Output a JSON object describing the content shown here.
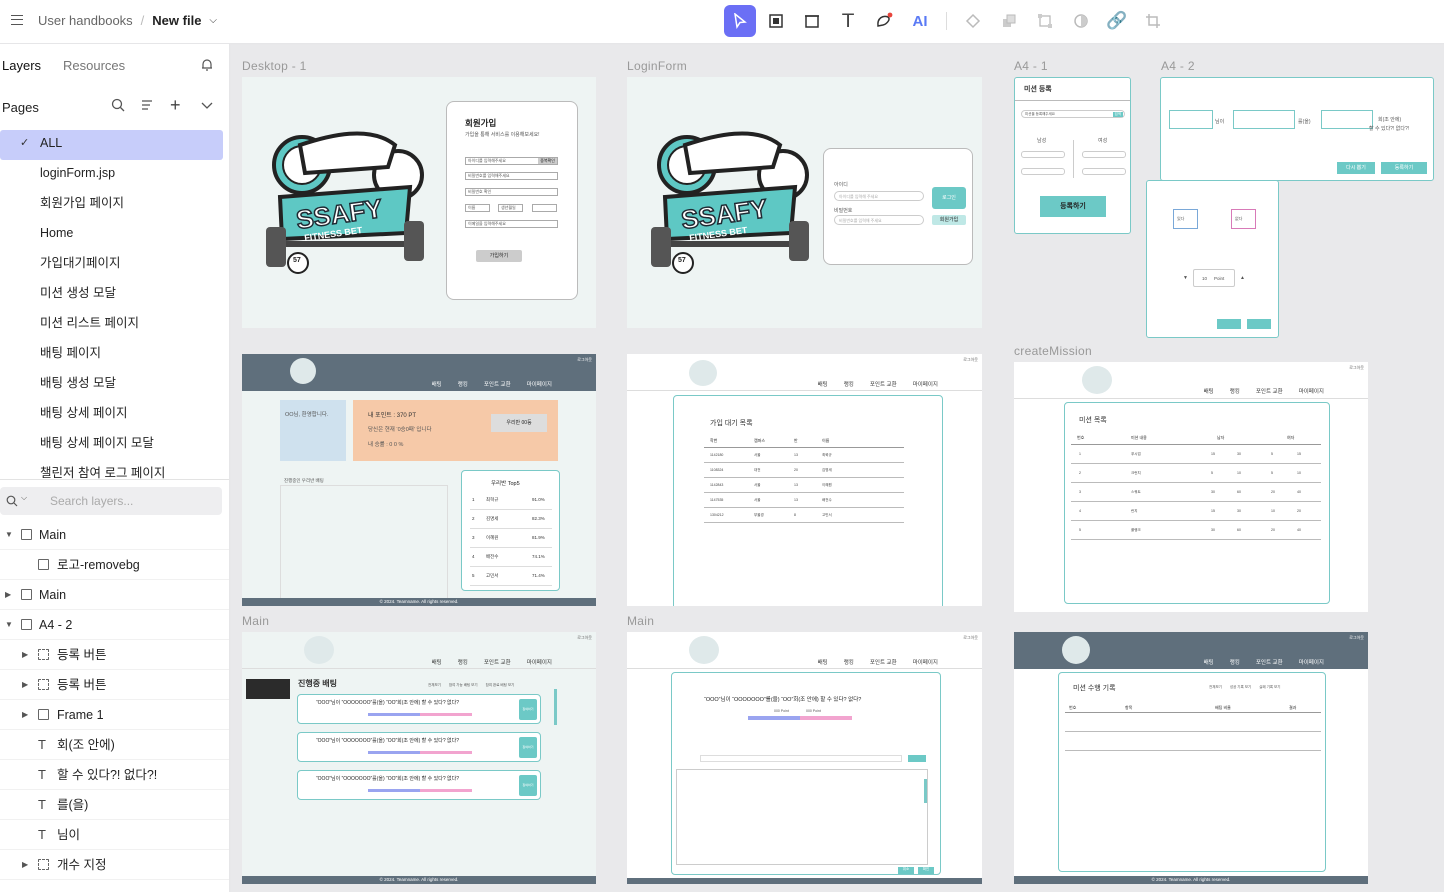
{
  "breadcrumb": {
    "project": "User handbooks",
    "separator": "/",
    "file": "New file"
  },
  "toolbar": {
    "tools": [
      "pointer-tool",
      "rectangle-tool",
      "frame-tool",
      "text-tool",
      "path-tool",
      "ai-tool",
      "component-tool",
      "group-tool",
      "transform-tool",
      "mask-tool",
      "link-tool",
      "crop-tool"
    ],
    "ai_label": "AI",
    "text_glyph": "T"
  },
  "sidebar": {
    "tab_layers": "Layers",
    "tab_resources": "Resources",
    "pages_label": "Pages",
    "pages": [
      "ALL",
      "loginForm.jsp",
      "회원가입 페이지",
      "Home",
      "가입대기페이지",
      "미션 생성 모달",
      "미션 리스트 페이지",
      "배팅 페이지",
      "배팅 생성 모달",
      "배팅 상세 페이지",
      "배팅 상세 페이지 모달",
      "챌린저 참여 로그 페이지"
    ],
    "search_placeholder": "Search layers...",
    "layers": [
      {
        "name": "Main",
        "type": "board",
        "expanded": true,
        "depth": 0
      },
      {
        "name": "로고-removebg",
        "type": "image",
        "depth": 1
      },
      {
        "name": "Main",
        "type": "board",
        "expanded": false,
        "depth": 0
      },
      {
        "name": "A4 - 2",
        "type": "board",
        "expanded": true,
        "depth": 0
      },
      {
        "name": "등록 버튼",
        "type": "group",
        "depth": 1
      },
      {
        "name": "등록 버튼",
        "type": "group",
        "depth": 1
      },
      {
        "name": "Frame 1",
        "type": "board",
        "depth": 1
      },
      {
        "name": "회(조 안에)",
        "type": "text",
        "depth": 1
      },
      {
        "name": "할 수 있다?! 없다?!",
        "type": "text",
        "depth": 1
      },
      {
        "name": "를(을)",
        "type": "text",
        "depth": 1
      },
      {
        "name": "님이",
        "type": "text",
        "depth": 1
      },
      {
        "name": "개수 지정",
        "type": "group",
        "depth": 1
      }
    ]
  },
  "canvas": {
    "frame_labels": {
      "desktop1": "Desktop - 1",
      "loginform": "LoginForm",
      "a4_1": "A4 - 1",
      "a4_2": "A4 - 2",
      "createmission": "createMission",
      "main1": "Main",
      "main2": "Main"
    },
    "brand": {
      "logo_line1": "SSAFY",
      "logo_line2": "FITNESS BET",
      "logo_number": "57"
    },
    "signup": {
      "title": "회원가입",
      "subtitle": "가입을 통해 서비스를 이용해보세요!",
      "button": "가입하기",
      "dup_check": "중복확인",
      "fields": [
        "아이디를 입력해주세요",
        "비밀번호를 입력해주세요",
        "비밀번호 확인",
        "이름",
        "생년월일",
        "이메일을 입력해주세요"
      ]
    },
    "login": {
      "id_label": "아이디",
      "pw_label": "비밀번호",
      "id_placeholder": "아이디를 입력해 주세요",
      "pw_placeholder": "비밀번호를 입력해 주세요",
      "login_button": "로그인",
      "signup_button": "회원가입"
    },
    "a4_1": {
      "title": "미션 등록",
      "input_placeholder": "미션을 등록해주세요",
      "search": "검색",
      "male": "남성",
      "female": "여성",
      "submit": "등록하기"
    },
    "a4_2": {
      "nim": "님이",
      "reul": "를(을)",
      "hoe": "회(조 안에)",
      "question": "할 수 있다?! 없다?!",
      "retry": "다시 뽑기",
      "register": "등록하기",
      "yes": "있다",
      "no": "없다",
      "point_value": "10",
      "point_unit": "Point"
    },
    "nav": {
      "logout": "로그아웃",
      "items": [
        "배팅",
        "랭킹",
        "포인트 교환",
        "마이페이지"
      ],
      "footer": "© 2024. Teamname. All rights reserved."
    },
    "home": {
      "welcome": "OO님, 환영합니다.",
      "mypoint": "내 포인트 : 370 PT",
      "status": "당신은 현재 ‘0승0패’ 입니다",
      "winrate": "내 승률 : 0 0 %",
      "team_btn": "우리반 00등",
      "ongoing": "진행중인 우리반 배팅",
      "top5_title": "우리반 Top5",
      "top5": [
        [
          "1",
          "최혁규",
          "91.0%"
        ],
        [
          "2",
          "김명세",
          "82.3%"
        ],
        [
          "3",
          "이혜원",
          "81.9%"
        ],
        [
          "4",
          "배전수",
          "74.1%"
        ],
        [
          "5",
          "고민서",
          "71.4%"
        ]
      ]
    },
    "waiting": {
      "title": "가입 대기 목록",
      "headers": [
        "학번",
        "캠퍼스",
        "반",
        "이름"
      ],
      "rows": [
        [
          "1142180",
          "서울",
          "13",
          "최혁규"
        ],
        [
          "1108324",
          "대전",
          "20",
          "김명세"
        ],
        [
          "1142843",
          "서울",
          "13",
          "이혜원"
        ],
        [
          "1147535",
          "서울",
          "13",
          "배전수"
        ],
        [
          "1304212",
          "부울경",
          "8",
          "고민서"
        ]
      ]
    },
    "mission_list": {
      "title": "미션 목록",
      "headers": [
        "번호",
        "미션 내용",
        "남자",
        "여자"
      ],
      "rows": [
        [
          "1",
          "푸시업",
          "15",
          "30",
          "5",
          "15"
        ],
        [
          "2",
          "크런치",
          "5",
          "10",
          "5",
          "10"
        ],
        [
          "3",
          "스쿼트",
          "30",
          "60",
          "20",
          "40"
        ],
        [
          "4",
          "런지",
          "15",
          "30",
          "10",
          "20"
        ],
        [
          "5",
          "플랭크",
          "30",
          "60",
          "20",
          "40"
        ]
      ]
    },
    "betting": {
      "title": "진행중 배팅",
      "filters": [
        "전체보기",
        "참여 가능 배팅 보기",
        "참여 완료 배팅 보기"
      ],
      "question": "“OOO”님이 “OOOOOOO”를(을) “OO”회(조 안에) 할 수 있다? 없다?",
      "join": "참여하기",
      "yes_label": "가능",
      "no_label": "불가능",
      "percent": "00 %"
    },
    "bet_detail": {
      "question": "“OOO”님이 “OOOOOOO”를(을) “OO”회(조 안에) 할 수 있다? 없다?",
      "point_a": "000 Point",
      "point_b": "000 Point",
      "confirm": "확인",
      "cancel": "취소"
    },
    "log": {
      "title": "미션 수행 기록",
      "filters": [
        "전체보기",
        "성공 기록 보기",
        "실패 기록 보기"
      ],
      "headers": [
        "번호",
        "항목",
        "배팅 비율",
        "결과"
      ]
    }
  }
}
